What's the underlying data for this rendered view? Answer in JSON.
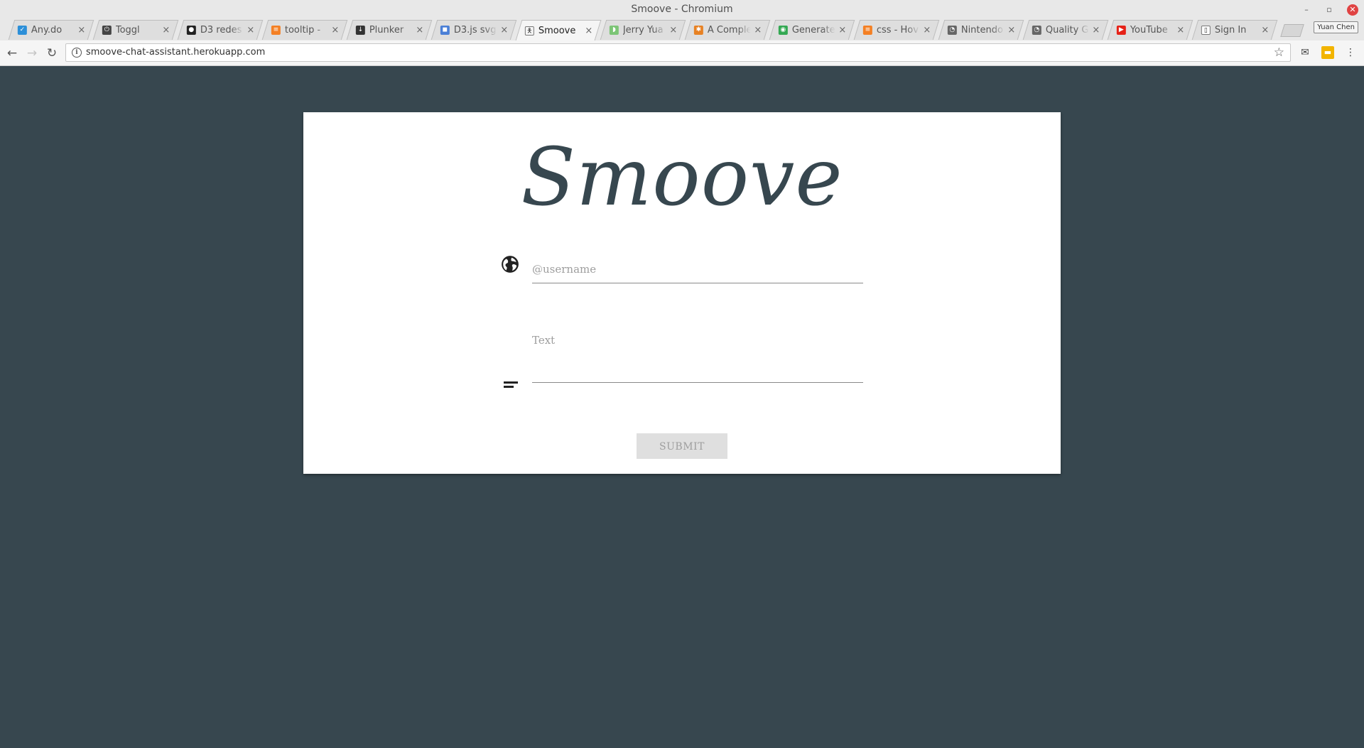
{
  "window": {
    "title": "Smoove - Chromium",
    "controls": {
      "minimize": "–",
      "restore": "▫",
      "close": "✕"
    },
    "profile_name": "Yuan Chen"
  },
  "tabs": [
    {
      "title": "Any.do",
      "favicon": "anydo-check-icon",
      "favicon_color": "#2c8fd8",
      "favicon_glyph": "✓",
      "active": false
    },
    {
      "title": "Toggl",
      "favicon": "toggl-power-icon",
      "favicon_color": "#444444",
      "favicon_glyph": "⏻",
      "active": false
    },
    {
      "title": "D3 redes",
      "favicon": "github-icon",
      "favicon_color": "#222222",
      "favicon_glyph": "●",
      "active": false
    },
    {
      "title": "tooltip -",
      "favicon": "stackoverflow-icon",
      "favicon_color": "#f48024",
      "favicon_glyph": "≡",
      "active": false
    },
    {
      "title": "Plunker",
      "favicon": "plunker-icon",
      "favicon_color": "#333333",
      "favicon_glyph": "↓",
      "active": false
    },
    {
      "title": "D3.js svg",
      "favicon": "google-groups-icon",
      "favicon_color": "#4a7fd6",
      "favicon_glyph": "◼",
      "active": false
    },
    {
      "title": "Smoove",
      "favicon": "smoove-figure-icon",
      "favicon_color": "#f5f5f5",
      "favicon_glyph": "🯅",
      "active": true
    },
    {
      "title": "Jerry Yua",
      "favicon": "android-icon",
      "favicon_color": "#7cc576",
      "favicon_glyph": "◗",
      "active": false
    },
    {
      "title": "A Comple",
      "favicon": "asterisk-icon",
      "favicon_color": "#e78123",
      "favicon_glyph": "✱",
      "active": false
    },
    {
      "title": "Generate",
      "favicon": "colorful-circle-icon",
      "favicon_color": "#33a852",
      "favicon_glyph": "◉",
      "active": false
    },
    {
      "title": "css - Hov",
      "favicon": "stackoverflow-icon",
      "favicon_color": "#f48024",
      "favicon_glyph": "≡",
      "active": false
    },
    {
      "title": "Nintendo",
      "favicon": "reddit-icon",
      "favicon_color": "#666666",
      "favicon_glyph": "◔",
      "active": false
    },
    {
      "title": "Quality G",
      "favicon": "reddit-icon",
      "favicon_color": "#666666",
      "favicon_glyph": "◔",
      "active": false
    },
    {
      "title": "YouTube",
      "favicon": "youtube-icon",
      "favicon_color": "#e62117",
      "favicon_glyph": "▶",
      "active": false
    },
    {
      "title": "Sign In",
      "favicon": "page-icon",
      "favicon_color": "#ffffff",
      "favicon_glyph": "▯",
      "active": false
    }
  ],
  "tab_close_glyph": "×",
  "toolbar": {
    "back_glyph": "←",
    "forward_glyph": "→",
    "reload_glyph": "↻",
    "info_glyph": "i",
    "url": "smoove-chat-assistant.herokuapp.com",
    "star_glyph": "☆",
    "extensions": [
      {
        "name": "mail-icon",
        "glyph": "✉"
      },
      {
        "name": "extension-yellow-icon",
        "glyph": "▬"
      },
      {
        "name": "menu-dots-icon",
        "glyph": "⋮"
      }
    ]
  },
  "page": {
    "background": "#37474f",
    "logo": "Smoove",
    "username_placeholder": "@username",
    "username_value": "",
    "text_placeholder": "Text",
    "text_value": "",
    "submit_label": "SUBMIT"
  }
}
